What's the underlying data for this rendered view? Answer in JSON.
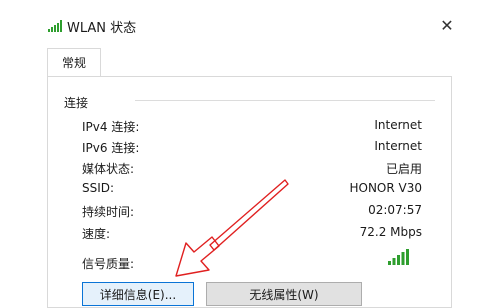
{
  "window": {
    "title": "WLAN 状态",
    "close_label": "✕",
    "icon": "wifi-signal-icon"
  },
  "tabs": [
    {
      "label": "常规",
      "selected": true
    }
  ],
  "section": {
    "title": "连接"
  },
  "rows": [
    {
      "label": "IPv4 连接:",
      "value": "Internet"
    },
    {
      "label": "IPv6 连接:",
      "value": "Internet"
    },
    {
      "label": "媒体状态:",
      "value": "已启用"
    },
    {
      "label": "SSID:",
      "value": "HONOR V30"
    },
    {
      "label": "持续时间:",
      "value": "02:07:57"
    },
    {
      "label": "速度:",
      "value": "72.2 Mbps"
    },
    {
      "label": "信号质量:",
      "value": ""
    }
  ],
  "signal_quality": {
    "bars": 5,
    "filled": 5,
    "icon": "signal-strength-icon",
    "color": "#2e9e2e"
  },
  "buttons": {
    "details_label": "详细信息(E)...",
    "wireless_props_label": "无线属性(W)"
  },
  "annotation": {
    "icon": "red-arrow-icon",
    "color": "#e02020"
  }
}
